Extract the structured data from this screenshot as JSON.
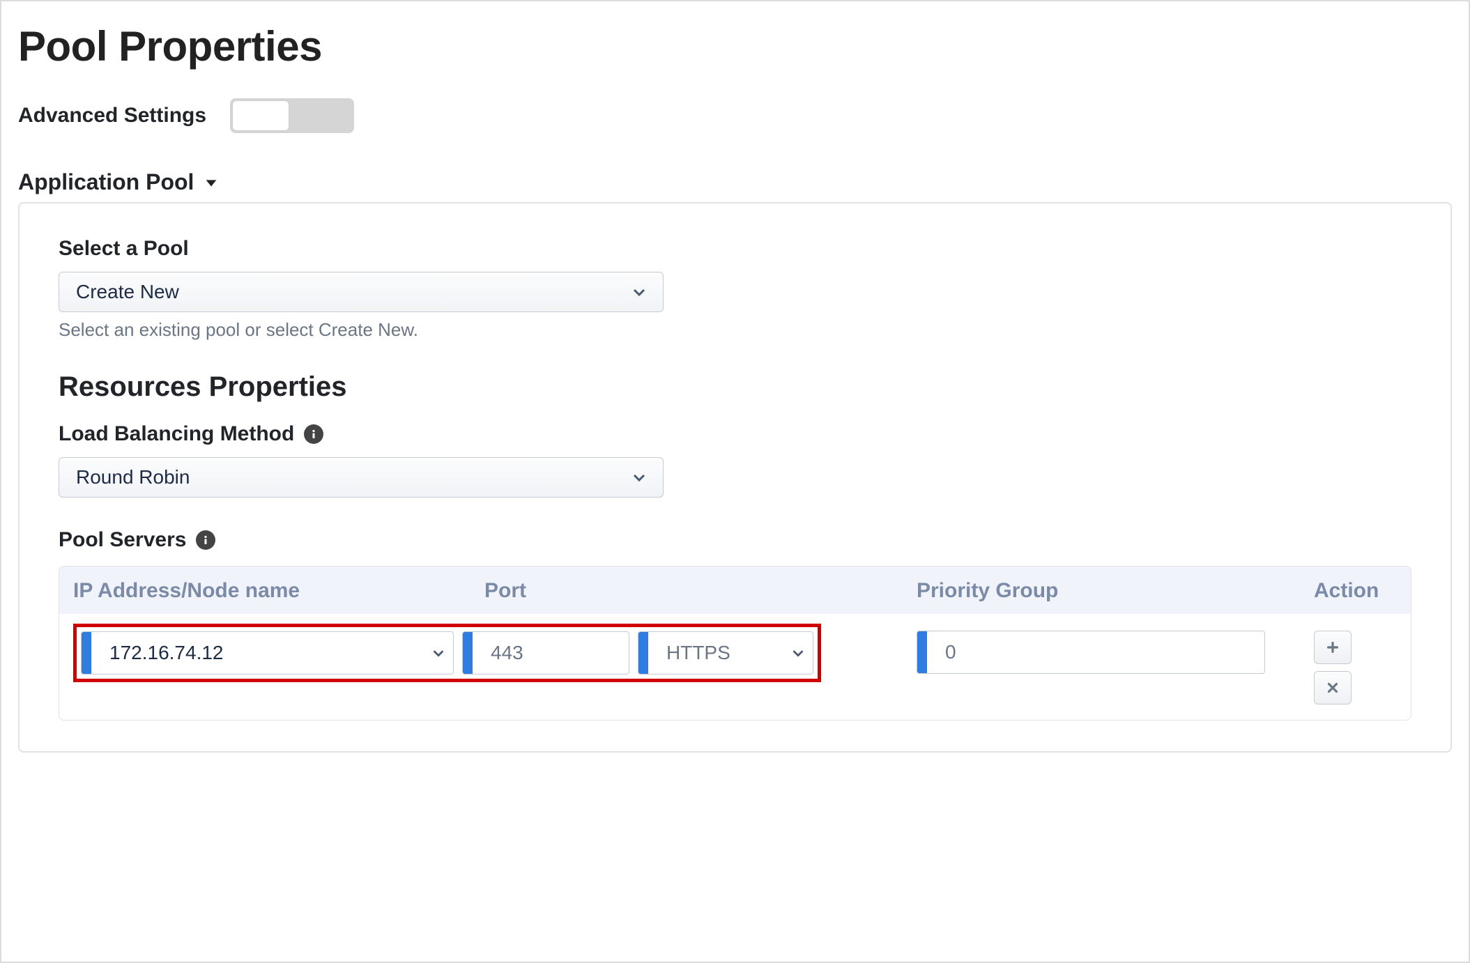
{
  "title": "Pool Properties",
  "advanced_settings_label": "Advanced Settings",
  "section_header": "Application Pool",
  "select_pool": {
    "label": "Select a Pool",
    "value": "Create New",
    "hint": "Select an existing pool or select Create New."
  },
  "resources_title": "Resources Properties",
  "lb_method": {
    "label": "Load Balancing Method",
    "value": "Round Robin"
  },
  "pool_servers_label": "Pool Servers",
  "table": {
    "headers": {
      "ip": "IP Address/Node name",
      "port": "Port",
      "priority": "Priority Group",
      "action": "Action"
    },
    "row": {
      "ip": "172.16.74.12",
      "port": "443",
      "protocol": "HTTPS",
      "priority": "0"
    }
  }
}
